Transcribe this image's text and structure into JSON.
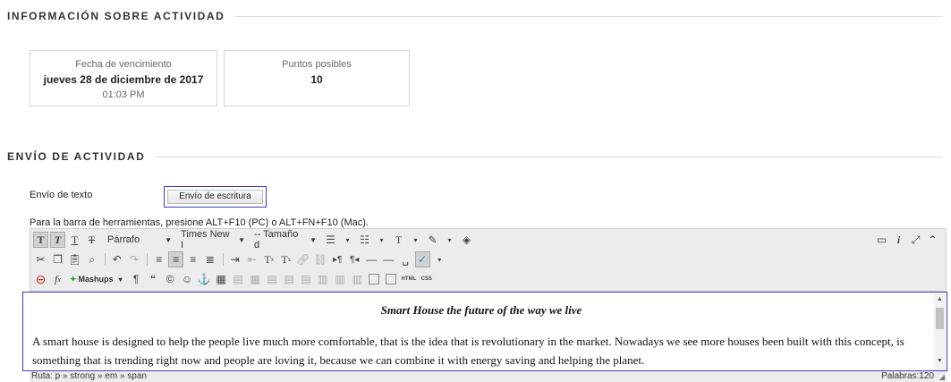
{
  "activity_info": {
    "title": "INFORMACIÓN SOBRE ACTIVIDAD",
    "due": {
      "label": "Fecha de vencimiento",
      "date": "jueves 28 de diciembre de 2017",
      "time": "01:03 PM"
    },
    "points": {
      "label": "Puntos posibles",
      "value": "10"
    }
  },
  "submission": {
    "title": "ENVÍO DE ACTIVIDAD",
    "text_label": "Envío de texto",
    "write_button": "Envío de escritura",
    "toolbar_hint": "Para la barra de herramientas, presione ALT+F10 (PC) o ALT+FN+F10 (Mac)."
  },
  "toolbar": {
    "paragraph": "Párrafo",
    "font_family": "Times New I",
    "font_size": "-- Tamaño d",
    "mashups": "Mashups",
    "html_label": "HTML",
    "css_label": "CSS"
  },
  "editor": {
    "heading": "Smart House the future of the way we live",
    "paragraph_1": "A smart house is designed to help the people live much more comfortable, that is the idea that is revolutionary in the market. Nowadays we see more houses been built with this concept, is something that is trending right now and people are loving it, because we can combine it with energy saving and helping the planet."
  },
  "statusbar": {
    "path": "Ruta: p » strong » em » span",
    "word_count": "Palabras:120"
  },
  "colors": {
    "accent_border": "#3b3bbf",
    "toolbar_bg": "#ececec",
    "red_icon": "#d9261c"
  }
}
